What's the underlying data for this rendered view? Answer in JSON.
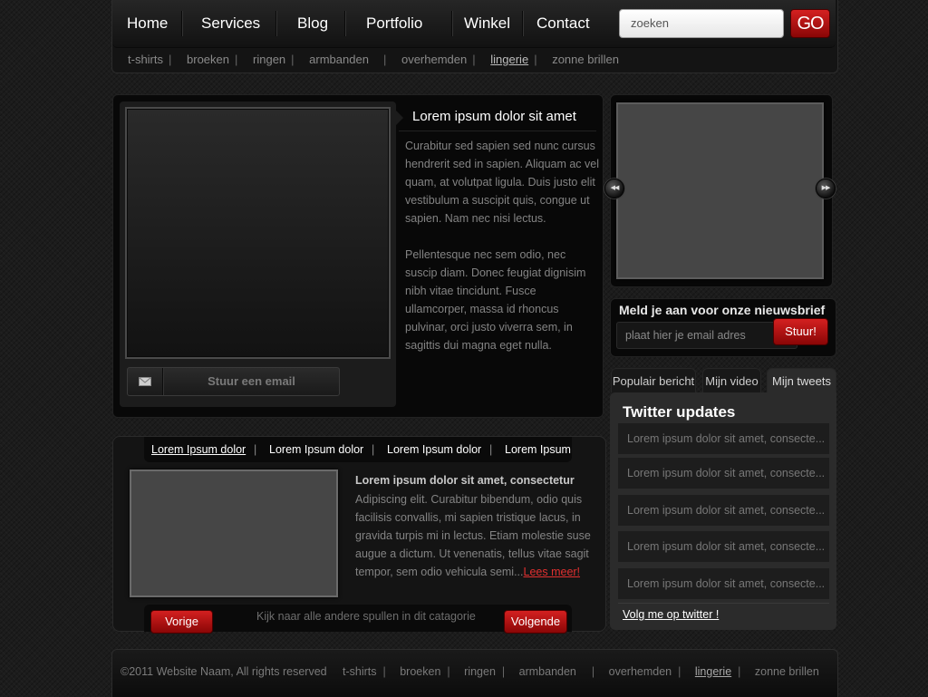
{
  "nav": {
    "items": [
      "Home",
      "Services",
      "Blog",
      "Portfolio",
      "Winkel",
      "Contact"
    ],
    "search_placeholder": "zoeken",
    "search_button": "GO"
  },
  "subnav": {
    "items": [
      "t-shirts",
      "broeken",
      "ringen",
      "armbanden",
      "overhemden",
      "lingerie",
      "zonne brillen"
    ],
    "active": "lingerie"
  },
  "featured": {
    "title": "Lorem ipsum dolor sit amet",
    "paragraph1": "Curabitur sed sapien sed nunc cursus hendrerit sed in sapien. Aliquam ac vel quam, at volutpat ligula. Duis justo elit vestibulum a suscipit quis, congue ut sapien. Nam nec nisi lectus.",
    "paragraph2": "Pellentesque nec sem odio, nec suscip diam. Donec feugiat dignisim nibh vitae tincidunt. Fusce ullamcorper, massa id rhoncus pulvinar, orci justo viverra sem, in sagittis dui magna eget nulla.",
    "email_button": "Stuur een email",
    "email_icon": "envelope-icon"
  },
  "slider": {
    "prev_icon": "rewind-icon",
    "next_icon": "fast-forward-icon"
  },
  "newsletter": {
    "title": "Meld je aan voor onze nieuwsbrief",
    "placeholder": "plaat hier je email adres",
    "button": "Stuur!"
  },
  "tabs_widget": {
    "tabs": [
      "Populair bericht",
      "Mijn video",
      "Mijn tweets"
    ],
    "active_tab": "Mijn tweets",
    "title": "Twitter updates",
    "tweets": [
      "Lorem ipsum dolor sit amet, consecte...",
      "Lorem ipsum dolor sit amet, consecte...",
      "Lorem ipsum dolor sit amet, consecte...",
      "Lorem ipsum dolor sit amet, consecte...",
      "Lorem ipsum dolor sit amet, consecte..."
    ],
    "follow_link": "Volg me op twitter !"
  },
  "products": {
    "tabs": [
      "Lorem Ipsum dolor",
      "Lorem Ipsum dolor",
      "Lorem Ipsum dolor",
      "Lorem Ipsum"
    ],
    "separator": "|",
    "active_tab_index": 0,
    "title": "Lorem ipsum dolor sit amet, consectetur",
    "text": "Adipiscing elit. Curabitur bibendum, odio quis facilisis convallis, mi sapien tristique lacus, in gravida turpis mi in lectus. Etiam molestie suse augue a dictum. Ut venenatis, tellus vitae sagit tempor, sem odio vehicula semi...",
    "read_more": "Lees meer!",
    "prev_button": "Vorige",
    "next_button": "Volgende",
    "note": "Kijk naar alle andere spullen in dit catagorie"
  },
  "footer": {
    "copyright": "©2011   Website Naam, All rights reserved",
    "links": [
      "t-shirts",
      "broeken",
      "ringen",
      "armbanden",
      "overhemden",
      "lingerie",
      "zonne brillen"
    ],
    "active": "lingerie"
  },
  "colors": {
    "accent_red": "#c41212",
    "background": "#1c1c1c",
    "panel": "#080808"
  }
}
